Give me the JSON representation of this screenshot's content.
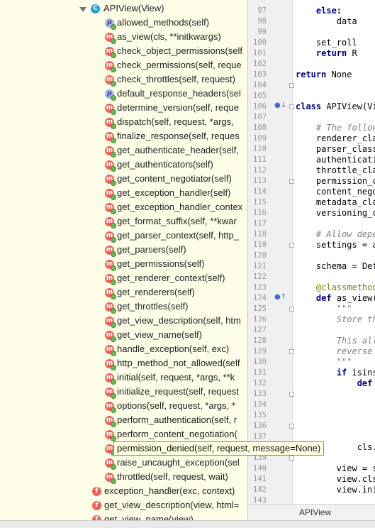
{
  "structure": {
    "class_name": "APIView(View)",
    "members": [
      {
        "icon": "p",
        "label": "allowed_methods(self)"
      },
      {
        "icon": "m",
        "label": "as_view(cls, **initkwargs)"
      },
      {
        "icon": "m",
        "label": "check_object_permissions(self"
      },
      {
        "icon": "m",
        "label": "check_permissions(self, reque"
      },
      {
        "icon": "m",
        "label": "check_throttles(self, request)"
      },
      {
        "icon": "p",
        "label": "default_response_headers(sel"
      },
      {
        "icon": "m",
        "label": "determine_version(self, reque"
      },
      {
        "icon": "m",
        "label": "dispatch(self, request, *args,"
      },
      {
        "icon": "m",
        "label": "finalize_response(self, reques"
      },
      {
        "icon": "m",
        "label": "get_authenticate_header(self,"
      },
      {
        "icon": "m",
        "label": "get_authenticators(self)"
      },
      {
        "icon": "m",
        "label": "get_content_negotiator(self)"
      },
      {
        "icon": "m",
        "label": "get_exception_handler(self)"
      },
      {
        "icon": "m",
        "label": "get_exception_handler_contex"
      },
      {
        "icon": "m",
        "label": "get_format_suffix(self, **kwar"
      },
      {
        "icon": "m",
        "label": "get_parser_context(self, http_"
      },
      {
        "icon": "m",
        "label": "get_parsers(self)"
      },
      {
        "icon": "m",
        "label": "get_permissions(self)"
      },
      {
        "icon": "m",
        "label": "get_renderer_context(self)"
      },
      {
        "icon": "m",
        "label": "get_renderers(self)"
      },
      {
        "icon": "m",
        "label": "get_throttles(self)"
      },
      {
        "icon": "m",
        "label": "get_view_description(self, htm"
      },
      {
        "icon": "m",
        "label": "get_view_name(self)"
      },
      {
        "icon": "m",
        "label": "handle_exception(self, exc)"
      },
      {
        "icon": "m",
        "label": "http_method_not_allowed(self"
      },
      {
        "icon": "m",
        "label": "initial(self, request, *args, **k"
      },
      {
        "icon": "m",
        "label": "initialize_request(self, request"
      },
      {
        "icon": "m",
        "label": "options(self, request, *args, *"
      },
      {
        "icon": "m",
        "label": "perform_authentication(self, r"
      },
      {
        "icon": "m",
        "label": "perform_content_negotiation("
      },
      {
        "icon": "m",
        "label": "permission_denied(self, request, message=None)"
      },
      {
        "icon": "m",
        "label": "raise_uncaught_exception(sel"
      },
      {
        "icon": "m",
        "label": "throttled(self, request, wait)"
      }
    ],
    "functions": [
      {
        "icon": "f",
        "label": "exception_handler(exc, context)"
      },
      {
        "icon": "f",
        "label": "get_view_description(view, html="
      },
      {
        "icon": "f",
        "label": "get_view_name(view)"
      }
    ]
  },
  "tooltip": "permission_denied(self, request, message=None)",
  "editor": {
    "lines": [
      {
        "n": "97",
        "t": "    else:"
      },
      {
        "n": "98",
        "t": "        data"
      },
      {
        "n": "99",
        "t": ""
      },
      {
        "n": "100",
        "t": "    set_roll"
      },
      {
        "n": "101",
        "t": "    return R"
      },
      {
        "n": "102",
        "t": ""
      },
      {
        "n": "103",
        "t": "return None"
      },
      {
        "n": "104",
        "t": ""
      },
      {
        "n": "105",
        "t": ""
      },
      {
        "n": "106",
        "t": "class APIView(Vi"
      },
      {
        "n": "107",
        "t": ""
      },
      {
        "n": "108",
        "t": "    # The follow"
      },
      {
        "n": "109",
        "t": "    renderer_cla"
      },
      {
        "n": "110",
        "t": "    parser_class"
      },
      {
        "n": "111",
        "t": "    authenticati"
      },
      {
        "n": "112",
        "t": "    throttle_cla"
      },
      {
        "n": "113",
        "t": "    permission_c"
      },
      {
        "n": "114",
        "t": "    content_nego"
      },
      {
        "n": "115",
        "t": "    metadata_cla"
      },
      {
        "n": "116",
        "t": "    versioning_c"
      },
      {
        "n": "117",
        "t": ""
      },
      {
        "n": "118",
        "t": "    # Allow depe"
      },
      {
        "n": "119",
        "t": "    settings = a"
      },
      {
        "n": "120",
        "t": ""
      },
      {
        "n": "121",
        "t": "    schema = Def"
      },
      {
        "n": "122",
        "t": ""
      },
      {
        "n": "123",
        "t": "    @classmethod"
      },
      {
        "n": "124",
        "t": "    def as_view("
      },
      {
        "n": "125",
        "t": "        \"\"\""
      },
      {
        "n": "126",
        "t": "        Store th"
      },
      {
        "n": "127",
        "t": ""
      },
      {
        "n": "128",
        "t": "        This all"
      },
      {
        "n": "129",
        "t": "        reverse"
      },
      {
        "n": "130",
        "t": "        \"\"\""
      },
      {
        "n": "131",
        "t": "        if isins"
      },
      {
        "n": "132",
        "t": "            def"
      },
      {
        "n": "133",
        "t": ""
      },
      {
        "n": "134",
        "t": ""
      },
      {
        "n": "135",
        "t": ""
      },
      {
        "n": "136",
        "t": ""
      },
      {
        "n": "137",
        "t": ""
      },
      {
        "n": "138",
        "t": "            cls."
      },
      {
        "n": "139",
        "t": ""
      },
      {
        "n": "140",
        "t": "        view = s"
      },
      {
        "n": "141",
        "t": "        view.cls"
      },
      {
        "n": "142",
        "t": "        view.ini"
      },
      {
        "n": "143",
        "t": ""
      }
    ],
    "breadcrumb": "APIView"
  }
}
